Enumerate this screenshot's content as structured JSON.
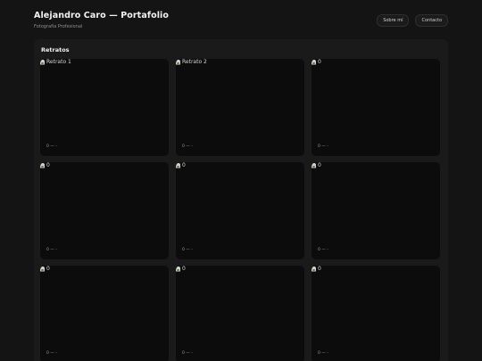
{
  "header": {
    "title": "Alejandro Caro — Portafolio",
    "subtitle": "Fotografía Profesional",
    "nav": [
      "Sobre mí",
      "Contacto"
    ]
  },
  "gallery": {
    "title": "Retratos",
    "items": [
      {
        "alt": "Retrato 1",
        "meta": "0 — -"
      },
      {
        "alt": "Retrato 2",
        "meta": "0 — -"
      },
      {
        "alt": "0",
        "meta": "0 — -"
      },
      {
        "alt": "0",
        "meta": "0 — -"
      },
      {
        "alt": "0",
        "meta": "0 — -"
      },
      {
        "alt": "0",
        "meta": "0 — -"
      },
      {
        "alt": "0",
        "meta": "0 — -"
      },
      {
        "alt": "0",
        "meta": "0 — -"
      },
      {
        "alt": "0",
        "meta": "0 — -"
      }
    ]
  },
  "colors": {
    "background": "#141414",
    "panel": "#1a1a1a",
    "card": "#0c0c0c",
    "text": "#f2f2f2",
    "muted": "#8f8f8f"
  },
  "icons": {
    "thumbnail": "broken-image-icon"
  }
}
